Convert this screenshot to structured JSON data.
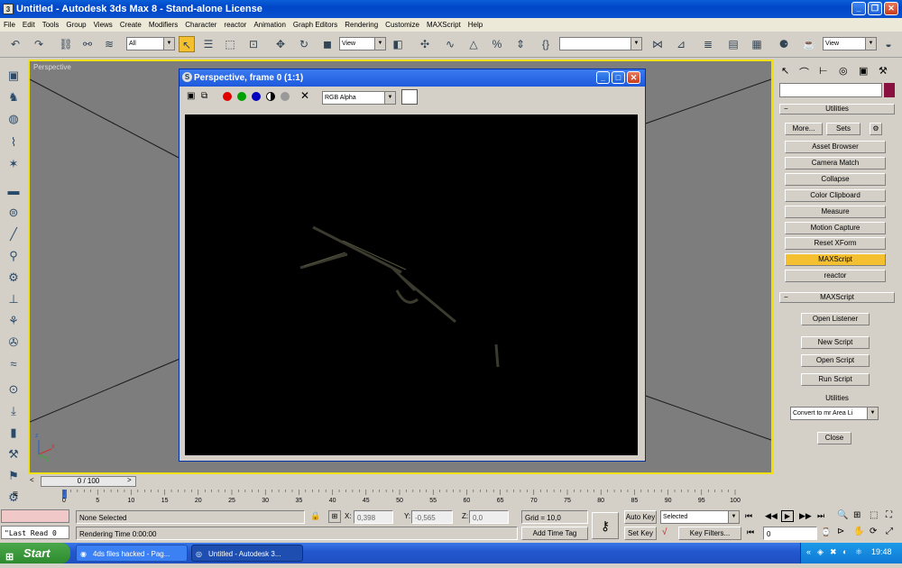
{
  "window": {
    "title": "Untitled - Autodesk 3ds Max 8 - Stand-alone License",
    "controls": {
      "minimize": "_",
      "maximize": "❐",
      "close": "✕"
    }
  },
  "menu": [
    "File",
    "Edit",
    "Tools",
    "Group",
    "Views",
    "Create",
    "Modifiers",
    "Character",
    "reactor",
    "Animation",
    "Graph Editors",
    "Rendering",
    "Customize",
    "MAXScript",
    "Help"
  ],
  "toolbar": {
    "selection_filter": "All",
    "reference_coord": "View",
    "named_selection": "",
    "render_type": "View"
  },
  "viewport": {
    "label": "Perspective",
    "axis_labels": {
      "x": "x",
      "y": "y",
      "z": "z"
    }
  },
  "render_window": {
    "title": "Perspective, frame 0 (1:1)",
    "channel_combo": "RGB Alpha"
  },
  "command_panel": {
    "utilities_title": "Utilities",
    "more_label": "More...",
    "sets_label": "Sets",
    "utility_buttons": [
      "Asset Browser",
      "Camera Match",
      "Collapse",
      "Color Clipboard",
      "Measure",
      "Motion Capture",
      "Reset XForm",
      "MAXScript",
      "reactor"
    ],
    "active_utility": "MAXScript",
    "maxscript_title": "MAXScript",
    "open_listener": "Open Listener",
    "new_script": "New Script",
    "open_script": "Open Script",
    "run_script": "Run Script",
    "utilities_label": "Utilities",
    "utilities_dropdown": "Convert to mr Area Li",
    "close_label": "Close"
  },
  "timeline": {
    "slider_label": "0 / 100",
    "ticks": [
      "0",
      "5",
      "10",
      "15",
      "20",
      "25",
      "30",
      "35",
      "40",
      "45",
      "50",
      "55",
      "60",
      "65",
      "70",
      "75",
      "80",
      "85",
      "90",
      "95",
      "100"
    ]
  },
  "status": {
    "listener_text": "\"Last Read 0",
    "selection": "None Selected",
    "rendering_time": "Rendering Time  0:00:00",
    "x_label": "X:",
    "x_value": "0,398",
    "y_label": "Y:",
    "y_value": "-0,565",
    "z_label": "Z:",
    "z_value": "0,0",
    "grid": "Grid = 10,0",
    "add_time_tag": "Add Time Tag",
    "auto_key": "Auto Key",
    "set_key": "Set Key",
    "key_filter_combo": "Selected",
    "key_filters": "Key Filters...",
    "frame_field": "0"
  },
  "taskbar": {
    "start": "Start",
    "tasks": [
      "4ds files hacked - Pag...",
      "Untitled - Autodesk 3..."
    ],
    "clock": "19:48"
  },
  "colors": {
    "accent_yellow": "#f4c030",
    "title_blue": "#0046c8",
    "render_bg": "#000000",
    "viewport_bg": "#7d7d7d"
  }
}
